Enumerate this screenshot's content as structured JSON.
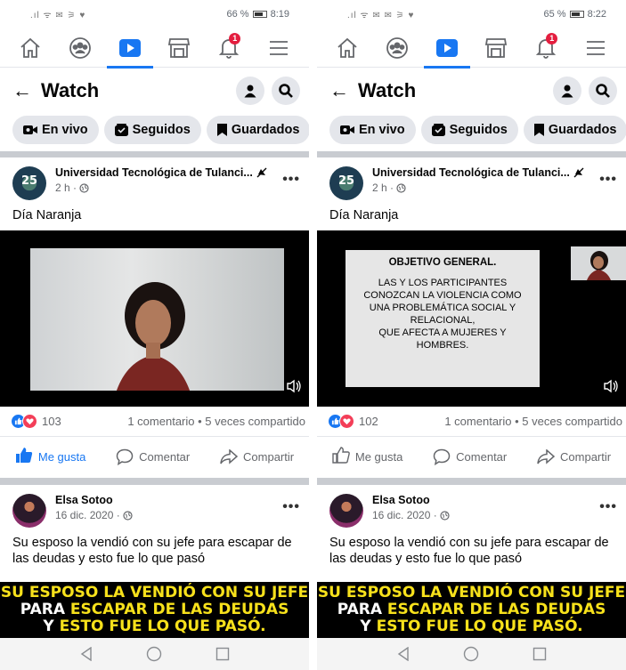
{
  "screens": [
    {
      "status": {
        "signals": ".ıl ᯤ ✉ ⚞ ♥",
        "battery": "66 %",
        "time": "8:19"
      },
      "header": {
        "title": "Watch"
      },
      "chips": [
        {
          "label": "En vivo"
        },
        {
          "label": "Seguidos"
        },
        {
          "label": "Guardados"
        }
      ],
      "notif_count": "1",
      "post1": {
        "author": "Universidad Tecnológica de Tulanci...",
        "time": "2 h ·",
        "text": "Día Naranja",
        "reactions": "103",
        "stats": "1 comentario • 5 veces compartido",
        "like_label": "Me gusta",
        "comment_label": "Comentar",
        "share_label": "Compartir"
      },
      "post2": {
        "author": "Elsa Sotoo",
        "time": "16 dic. 2020 ·",
        "text": "Su esposo la vendió con su jefe para escapar de las deudas y esto fue lo que pasó"
      }
    },
    {
      "status": {
        "signals": ".ıl ᯤ ✉ ✉ ⚞ ♥",
        "battery": "65 %",
        "time": "8:22"
      },
      "header": {
        "title": "Watch"
      },
      "chips": [
        {
          "label": "En vivo"
        },
        {
          "label": "Seguidos"
        },
        {
          "label": "Guardados"
        }
      ],
      "notif_count": "1",
      "post1": {
        "author": "Universidad Tecnológica de Tulanci...",
        "time": "2 h ·",
        "text": "Día Naranja",
        "reactions": "102",
        "stats": "1 comentario • 5 veces compartido",
        "like_label": "Me gusta",
        "comment_label": "Comentar",
        "share_label": "Compartir"
      },
      "post2": {
        "author": "Elsa Sotoo",
        "time": "16 dic. 2020 ·",
        "text": "Su esposo la vendió con su jefe para escapar de las deudas y esto fue lo que pasó"
      }
    }
  ],
  "slide": {
    "title": "OBJETIVO GENERAL.",
    "body": "LAS Y LOS PARTICIPANTES\nCONOZCAN LA VIOLENCIA COMO\nUNA PROBLEMÁTICA SOCIAL Y\nRELACIONAL,\nQUE AFECTA A MUJERES Y\nHOMBRES."
  },
  "thumbnail": {
    "line1_yellow": "SU ESPOSO LA VENDIÓ CON SU JEFE",
    "line2_white": "PARA ",
    "line2_yellow": "ESCAPAR DE LAS DEUDAS",
    "line3_white": "Y ",
    "line3_yellow": "ESTO FUE LO QUE PASÓ."
  },
  "colors": {
    "accent": "#1877f2",
    "love": "#f33e58",
    "badge": "#e41e3f",
    "banner_yellow": "#f7e11b"
  },
  "icons": [
    "home-icon",
    "groups-icon",
    "watch-icon",
    "marketplace-icon",
    "bell-icon",
    "menu-icon",
    "back-arrow-icon",
    "profile-icon",
    "search-icon",
    "camera-icon",
    "feed-icon",
    "bookmark-icon",
    "muted-icon",
    "globe-icon",
    "volume-icon",
    "like-icon",
    "comment-icon",
    "share-icon",
    "nav-back-icon",
    "nav-home-icon",
    "nav-recent-icon"
  ]
}
